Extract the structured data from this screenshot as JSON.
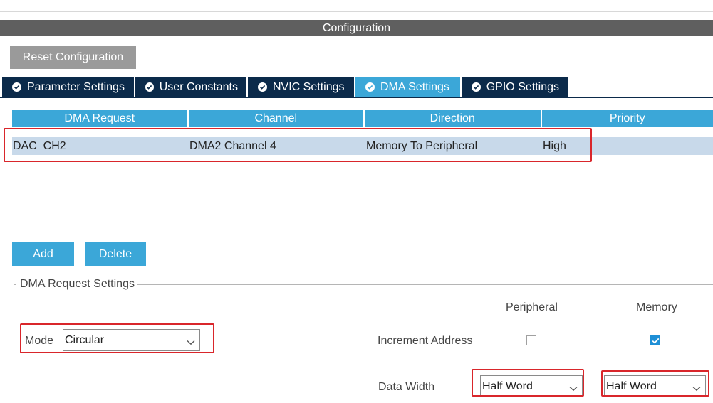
{
  "window": {
    "title": "Configuration"
  },
  "toolbar": {
    "reset_label": "Reset Configuration"
  },
  "tabs": [
    {
      "label": "Parameter Settings",
      "icon": "check-circle-icon",
      "active": false
    },
    {
      "label": "User Constants",
      "icon": "check-circle-icon",
      "active": false
    },
    {
      "label": "NVIC Settings",
      "icon": "check-circle-icon",
      "active": false
    },
    {
      "label": "DMA Settings",
      "icon": "check-circle-icon",
      "active": true
    },
    {
      "label": "GPIO Settings",
      "icon": "check-circle-icon",
      "active": false
    }
  ],
  "dma_table": {
    "columns": [
      "DMA Request",
      "Channel",
      "Direction",
      "Priority"
    ],
    "rows": [
      {
        "request": "DAC_CH2",
        "channel": "DMA2 Channel 4",
        "direction": "Memory To Peripheral",
        "priority": "High",
        "selected": true
      }
    ]
  },
  "buttons": {
    "add": "Add",
    "delete": "Delete"
  },
  "request_settings": {
    "title": "DMA Request Settings",
    "mode_label": "Mode",
    "mode_value": "Circular",
    "peripheral_label": "Peripheral",
    "memory_label": "Memory",
    "increment_label": "Increment Address",
    "peripheral_increment": false,
    "memory_increment": true,
    "data_width_label": "Data Width",
    "peripheral_width": "Half Word",
    "memory_width": "Half Word"
  },
  "colors": {
    "accent": "#3ba7d8",
    "tab_bg": "#0b2a4a",
    "highlight": "#d9262b",
    "selected_row": "#c8d9ea"
  }
}
